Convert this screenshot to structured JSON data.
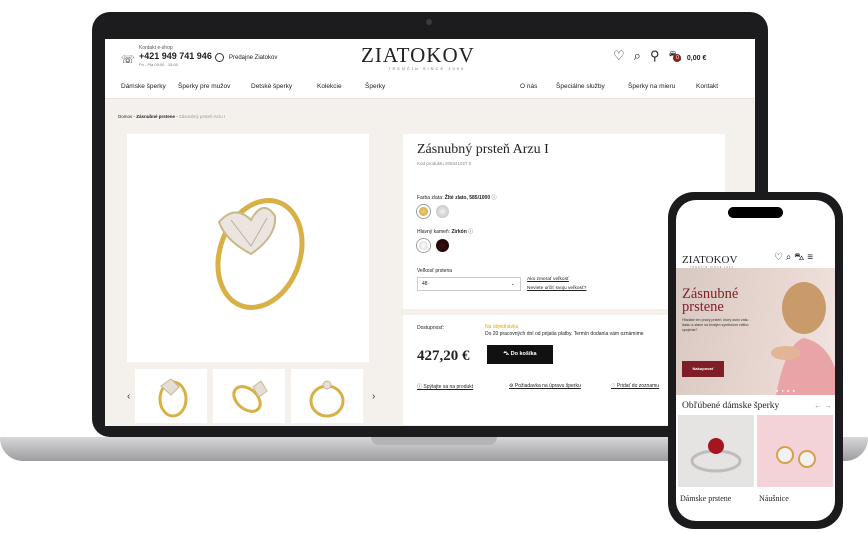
{
  "desktop": {
    "contact_label": "Kontakt e-shop",
    "phone": "+421 949 741 946",
    "hours": "Po - Pia 09:00 - 15:00",
    "stores_link": "Predajne Ziatokov",
    "logo": "ZIATOKOV",
    "logo_tagline": "TRENČÍN SINCE 1993",
    "cart_total": "0,00 €",
    "cart_count": "0",
    "nav_left": [
      "Dámske šperky",
      "Šperky pre mužov",
      "Detské šperky",
      "Kolekcie",
      "Šperky"
    ],
    "nav_right": [
      "O nás",
      "Špeciálne služby",
      "Šperky na mieru",
      "Kontakt"
    ],
    "breadcrumb": {
      "home": "Domov",
      "category": "Zásnubné prstene",
      "current": "Zásnubný prsteň Arzu I"
    },
    "product": {
      "title": "Zásnubný prsteň Arzu I",
      "code": "Kód produktu 209341027.0",
      "color_label": "Farba zlata:",
      "color_value": "Žlté zlato, 585/1000",
      "stone_label": "Hlavný kameň:",
      "stone_value": "Zirkón",
      "size_label": "Veľkosť prstena",
      "size_value": "48",
      "size_link_1": "Ako zmerať veľkosť",
      "size_link_2": "Neviete určiť svoju veľkosť?",
      "availability_label": "Dostupnosť:",
      "availability_value": "Na objednávku",
      "availability_note": "Do 20 pracovných dní od prijatia platby. Termín dodania vám oznámime",
      "price": "427,20 €",
      "add_to_cart": "Do košíka",
      "actions": [
        "Spýtajte sa na produkt",
        "Požiadavka na úpravu šperku",
        "Pridať do zoznamu"
      ]
    },
    "colors": {
      "accent": "#7e1e27",
      "gold": "#d9b24a"
    }
  },
  "mobile": {
    "logo": "ZIATOKOV",
    "logo_tagline": "TRENČÍN SINCE 1993",
    "cart_count": "0",
    "hero_title_1": "Zásnubné",
    "hero_title_2": "prstene",
    "hero_desc": "Hľadáte ten pravý prsteň, ktorý oslní vašu lásku a stane sa trvalým symbolom vášho spojenia?",
    "hero_button": "Nakupovať",
    "section_title": "Obľúbené dámske šperky",
    "cards": [
      "Dámske prstene",
      "Náušnice"
    ]
  }
}
